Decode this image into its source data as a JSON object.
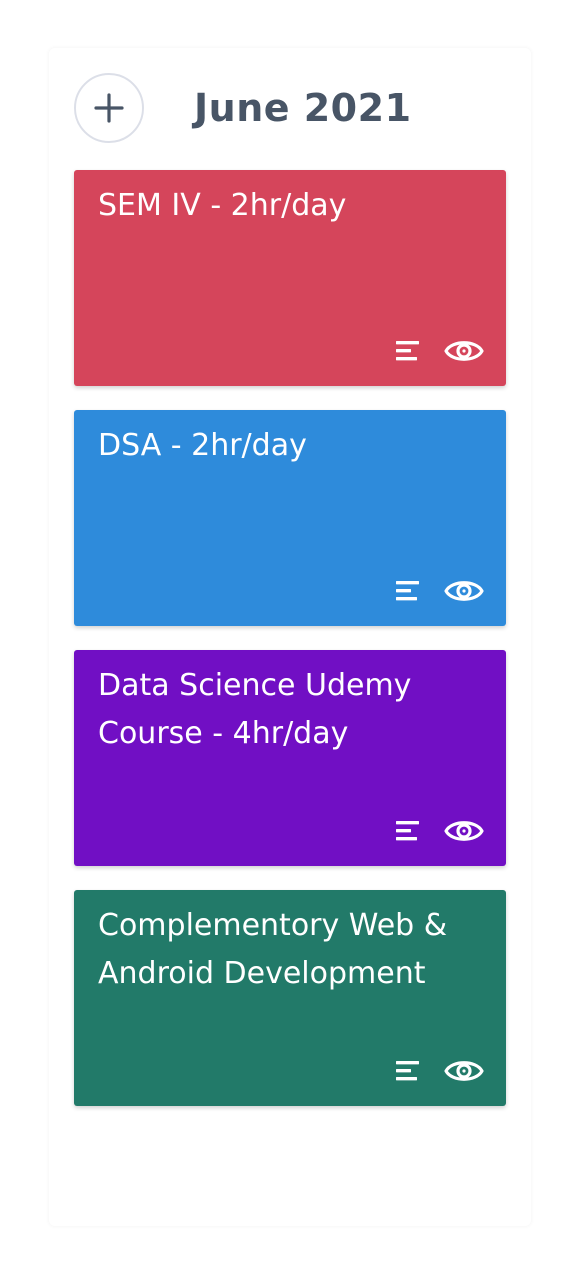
{
  "header": {
    "add_icon": "plus-icon",
    "title": "June 2021"
  },
  "cards": [
    {
      "title": "SEM IV - 2hr/day",
      "color": "#d5455b",
      "icons": [
        "lines-icon",
        "eye-icon"
      ]
    },
    {
      "title": "DSA - 2hr/day",
      "color": "#2e8bdb",
      "icons": [
        "lines-icon",
        "eye-icon"
      ]
    },
    {
      "title": "Data Science Udemy Course - 4hr/day",
      "color": "#710fc4",
      "icons": [
        "lines-icon",
        "eye-icon"
      ]
    },
    {
      "title": "Complementory Web & Android Development",
      "color": "#227a69",
      "icons": [
        "lines-icon",
        "eye-icon"
      ]
    }
  ]
}
